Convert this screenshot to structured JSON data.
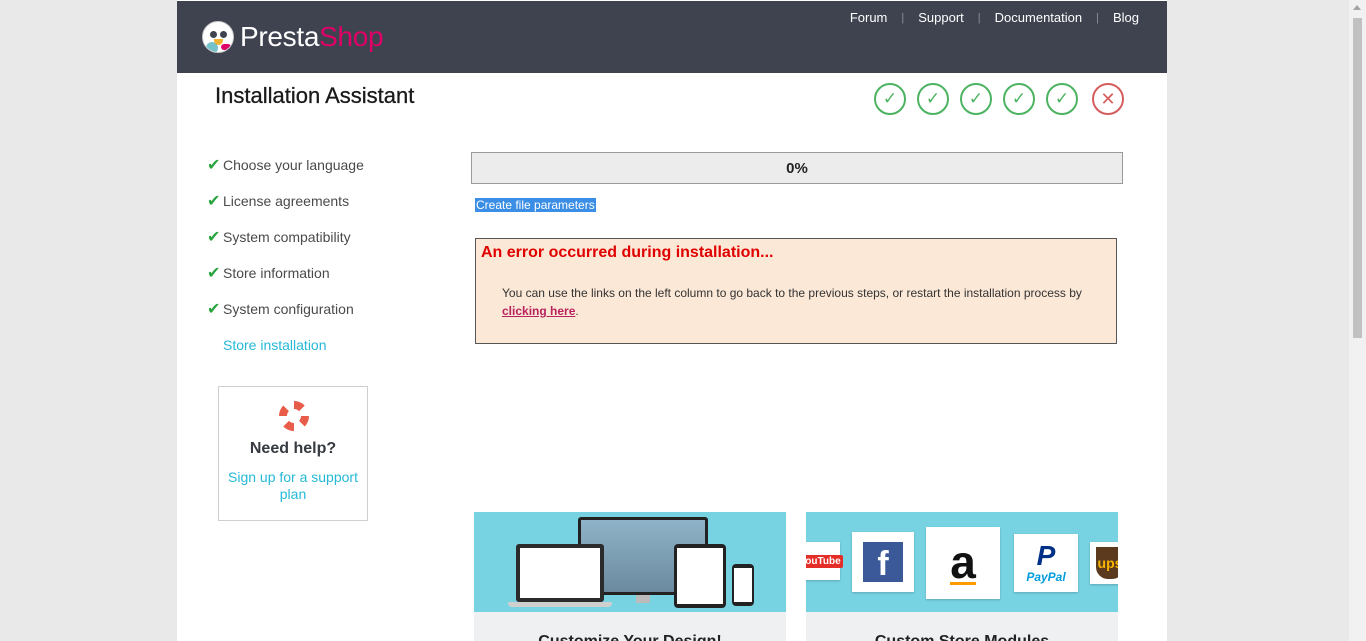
{
  "header": {
    "logo_part1": "Presta",
    "logo_part2": "Shop",
    "nav": [
      "Forum",
      "Support",
      "Documentation",
      "Blog"
    ]
  },
  "page_title": "Installation Assistant",
  "progress_steps": {
    "icons": [
      "check-icon",
      "check-icon",
      "check-icon",
      "check-icon",
      "check-icon",
      "close-icon"
    ],
    "check_glyph": "✓",
    "fail_glyph": "✕"
  },
  "sidebar": {
    "check_glyph": "✔",
    "items": [
      {
        "label": "Choose your language",
        "done": true
      },
      {
        "label": "License agreements",
        "done": true
      },
      {
        "label": "System compatibility",
        "done": true
      },
      {
        "label": "Store information",
        "done": true
      },
      {
        "label": "System configuration",
        "done": true
      },
      {
        "label": "Store installation",
        "done": false
      }
    ]
  },
  "help": {
    "title": "Need help?",
    "link": "Sign up for a support plan"
  },
  "progress": {
    "value": 0,
    "label": "0%"
  },
  "status_line": "Create file parameters",
  "error": {
    "title": "An error occurred during installation...",
    "message_before": "You can use the links on the left column to go back to the previous steps, or restart the installation process by ",
    "link": "clicking here",
    "message_after": "."
  },
  "promos": [
    {
      "title": "Customize Your Design!"
    },
    {
      "title": "Custom Store Modules"
    }
  ],
  "brand_tiles": {
    "youtube": "YouTube",
    "facebook": "f",
    "amazon": "a",
    "paypal_p": "P",
    "paypal_text": "PayPal",
    "ups": "ups"
  },
  "colors": {
    "header_bg": "#3e434f",
    "accent": "#25b9d7",
    "brand_pink": "#df0067",
    "success": "#4cb361",
    "error": "#d65d5d"
  }
}
